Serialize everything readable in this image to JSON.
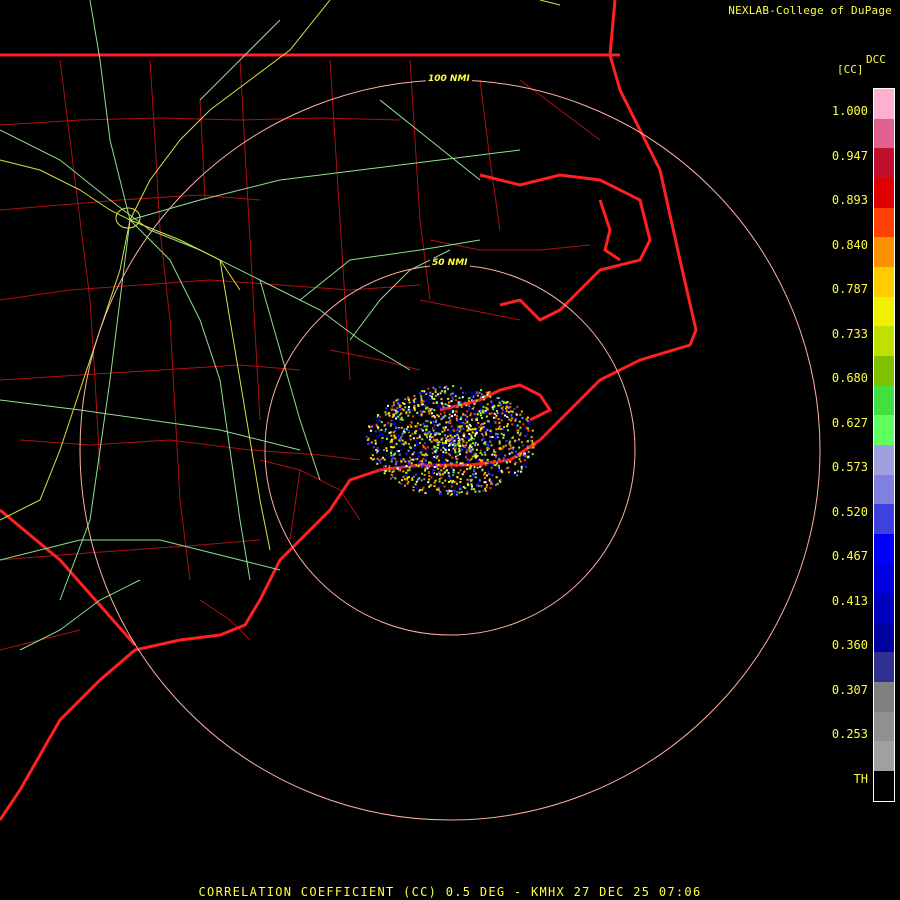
{
  "header": {
    "credit": "NEXLAB-College of DuPage"
  },
  "rings": {
    "inner_label": "50 NMI",
    "outer_label": "100 NMI"
  },
  "legend": {
    "product_code": "DCC",
    "unit": "[CC]",
    "ticks": [
      "1.000",
      "0.947",
      "0.893",
      "0.840",
      "0.787",
      "0.733",
      "0.680",
      "0.627",
      "0.573",
      "0.520",
      "0.467",
      "0.413",
      "0.360",
      "0.307",
      "0.253",
      "TH"
    ],
    "colors": [
      "#ffb0d0",
      "#e06090",
      "#c01030",
      "#e00000",
      "#ff4000",
      "#ff9000",
      "#ffcc00",
      "#f0f000",
      "#c0e000",
      "#80c000",
      "#40e040",
      "#60ff60",
      "#a0a0e0",
      "#8080e0",
      "#4040e0",
      "#0000ff",
      "#0000e0",
      "#0000c0",
      "#0000a0",
      "#303090",
      "#808080",
      "#909090",
      "#a0a0a0",
      "#000000"
    ]
  },
  "footer": {
    "text": "CORRELATION COEFFICIENT (CC) 0.5 DEG - KMHX 27 DEC 25 07:06"
  },
  "colors": {
    "label": "#ffff40",
    "coast": "#ff2020",
    "county": "#b01010",
    "road_green": "#90e090",
    "road_yellow": "#e0e040",
    "ring": "#ffb0a0"
  }
}
